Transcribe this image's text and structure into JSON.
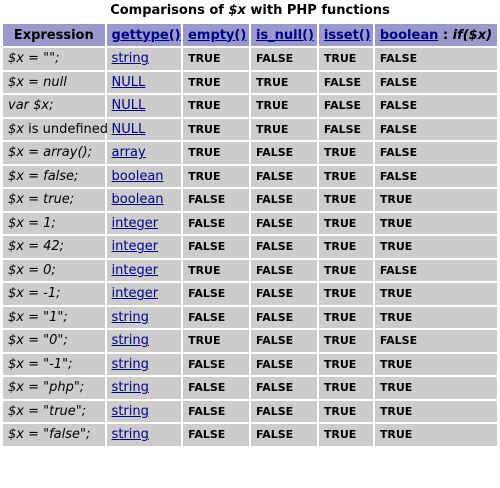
{
  "caption": {
    "prefix": "Comparisons of ",
    "var": "$x",
    "suffix": " with PHP functions"
  },
  "headers": {
    "expression": "Expression",
    "gettype": "gettype()",
    "empty": "empty()",
    "is_null": "is_null()",
    "isset": "isset()",
    "boolean": "boolean",
    "if_sep": " : ",
    "if_expr": "if($x)"
  },
  "rows": [
    {
      "expr_pre": "$x",
      "expr_mid": " = \"\";",
      "type": "string",
      "empty": "TRUE",
      "is_null": "FALSE",
      "isset": "TRUE",
      "boolean": "FALSE"
    },
    {
      "expr_pre": "$x",
      "expr_mid": " = null",
      "type": "NULL",
      "empty": "TRUE",
      "is_null": "TRUE",
      "isset": "FALSE",
      "boolean": "FALSE"
    },
    {
      "expr_pre": "var $x;",
      "expr_mid": "",
      "type": "NULL",
      "empty": "TRUE",
      "is_null": "TRUE",
      "isset": "FALSE",
      "boolean": "FALSE"
    },
    {
      "expr_pre": "$x",
      "expr_mid": " is undefined",
      "type": "NULL",
      "empty": "TRUE",
      "is_null": "TRUE",
      "isset": "FALSE",
      "boolean": "FALSE"
    },
    {
      "expr_pre": "$x",
      "expr_mid": " = array();",
      "type": "array",
      "empty": "TRUE",
      "is_null": "FALSE",
      "isset": "TRUE",
      "boolean": "FALSE"
    },
    {
      "expr_pre": "$x",
      "expr_mid": " = false;",
      "type": "boolean",
      "empty": "TRUE",
      "is_null": "FALSE",
      "isset": "TRUE",
      "boolean": "FALSE"
    },
    {
      "expr_pre": "$x",
      "expr_mid": " = true;",
      "type": "boolean",
      "empty": "FALSE",
      "is_null": "FALSE",
      "isset": "TRUE",
      "boolean": "TRUE"
    },
    {
      "expr_pre": "$x",
      "expr_mid": " = 1;",
      "type": "integer",
      "empty": "FALSE",
      "is_null": "FALSE",
      "isset": "TRUE",
      "boolean": "TRUE"
    },
    {
      "expr_pre": "$x",
      "expr_mid": " = 42;",
      "type": "integer",
      "empty": "FALSE",
      "is_null": "FALSE",
      "isset": "TRUE",
      "boolean": "TRUE"
    },
    {
      "expr_pre": "$x",
      "expr_mid": " = 0;",
      "type": "integer",
      "empty": "TRUE",
      "is_null": "FALSE",
      "isset": "TRUE",
      "boolean": "FALSE"
    },
    {
      "expr_pre": "$x",
      "expr_mid": " = -1;",
      "type": "integer",
      "empty": "FALSE",
      "is_null": "FALSE",
      "isset": "TRUE",
      "boolean": "TRUE"
    },
    {
      "expr_pre": "$x",
      "expr_mid": " = \"1\";",
      "type": "string",
      "empty": "FALSE",
      "is_null": "FALSE",
      "isset": "TRUE",
      "boolean": "TRUE"
    },
    {
      "expr_pre": "$x",
      "expr_mid": " = \"0\";",
      "type": "string",
      "empty": "TRUE",
      "is_null": "FALSE",
      "isset": "TRUE",
      "boolean": "FALSE"
    },
    {
      "expr_pre": "$x",
      "expr_mid": " = \"-1\";",
      "type": "string",
      "empty": "FALSE",
      "is_null": "FALSE",
      "isset": "TRUE",
      "boolean": "TRUE"
    },
    {
      "expr_pre": "$x",
      "expr_mid": " = \"php\";",
      "type": "string",
      "empty": "FALSE",
      "is_null": "FALSE",
      "isset": "TRUE",
      "boolean": "TRUE"
    },
    {
      "expr_pre": "$x",
      "expr_mid": " = \"true\";",
      "type": "string",
      "empty": "FALSE",
      "is_null": "FALSE",
      "isset": "TRUE",
      "boolean": "TRUE"
    },
    {
      "expr_pre": "$x",
      "expr_mid": " = \"false\";",
      "type": "string",
      "empty": "FALSE",
      "is_null": "FALSE",
      "isset": "TRUE",
      "boolean": "TRUE"
    }
  ],
  "colors": {
    "header_bg": "#9999cc",
    "cell_bg": "#cccccc",
    "link": "#00008b"
  }
}
